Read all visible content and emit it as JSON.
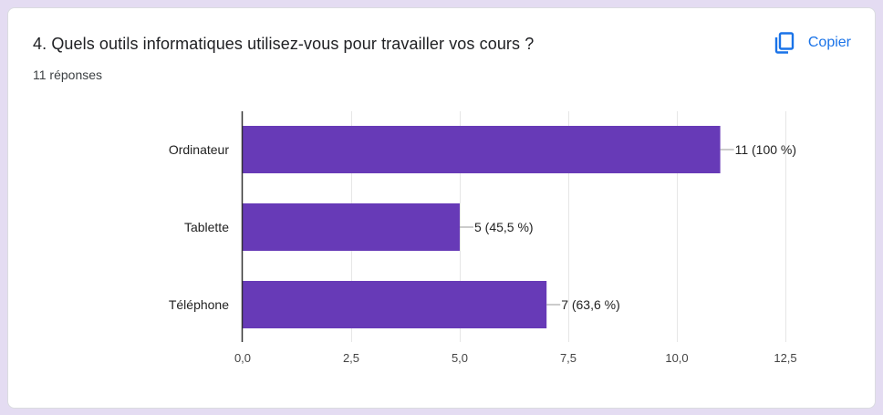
{
  "question": {
    "title": "4. Quels outils informatiques utilisez-vous pour travailler vos cours ?",
    "responses": "11 réponses"
  },
  "copy_button": {
    "label": "Copier",
    "icon": "copy-icon"
  },
  "colors": {
    "bar": "#673ab7",
    "accent": "#1a73e8",
    "grid": "#e6e6e6",
    "axis": "#333333",
    "text": "#222222"
  },
  "chart_data": {
    "type": "bar",
    "orientation": "horizontal",
    "categories": [
      "Ordinateur",
      "Tablette",
      "Téléphone"
    ],
    "values": [
      11,
      5,
      7
    ],
    "data_labels": [
      "11 (100 %)",
      "5 (45,5 %)",
      "7 (63,6 %)"
    ],
    "xlim": [
      0,
      12.5
    ],
    "xticks": [
      0,
      2.5,
      5,
      7.5,
      10,
      12.5
    ],
    "xtick_labels": [
      "0,0",
      "2,5",
      "5,0",
      "7,5",
      "10,0",
      "12,5"
    ],
    "grid": true
  }
}
